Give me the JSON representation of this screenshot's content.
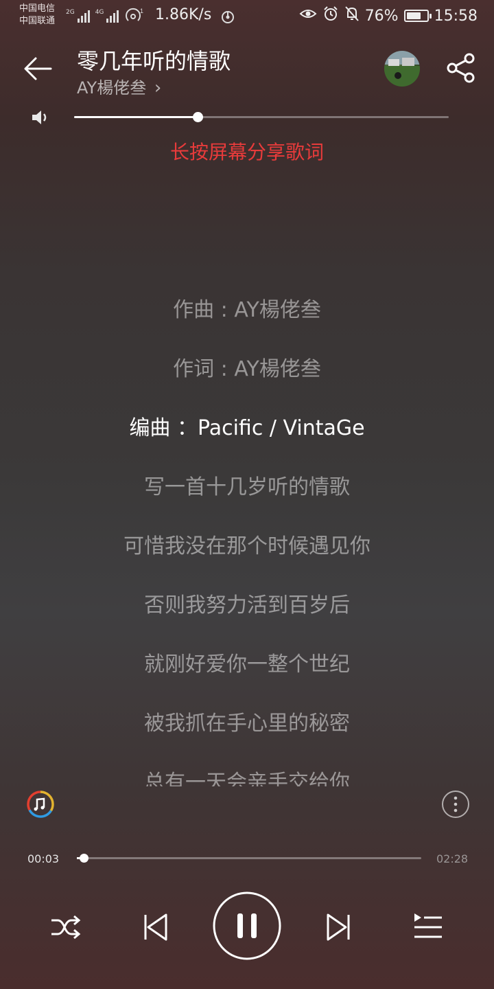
{
  "status_bar": {
    "carrier_1": "中国电信",
    "carrier_2": "中国联通",
    "network_1": "2G",
    "network_2": "4G",
    "net_speed": "1.86K/s",
    "battery": "76%",
    "battery_level": 0.76,
    "time": "15:58",
    "icons": [
      "signal-icon",
      "wifi-hotspot-icon",
      "sync-icon",
      "eye-icon",
      "alarm-icon",
      "mute-icon",
      "battery-icon"
    ]
  },
  "header": {
    "title": "零几年听的情歌",
    "artist": "AY楊佬叁",
    "artist_chevron": "›"
  },
  "volume": {
    "level": 0.33
  },
  "share_hint": "长按屏幕分享歌词",
  "lyrics": {
    "active_index": 2,
    "lines": [
      "作曲 : AY楊佬叁",
      "作词 : AY楊佬叁",
      "编曲 ：Pacific / VintaGe",
      "写一首十几岁听的情歌",
      "可惜我没在那个时候遇见你",
      "否则我努力活到百岁后",
      "就刚好爱你一整个世纪",
      "被我抓在手心里的秘密",
      "总有一天会亲手交给你"
    ]
  },
  "player": {
    "current_time": "00:03",
    "total_time": "02:28",
    "progress": 0.02
  },
  "colors": {
    "accent_hint": "#e83b3b",
    "text": "#ffffff",
    "lyric_dim": "rgba(255,255,255,0.48)"
  }
}
